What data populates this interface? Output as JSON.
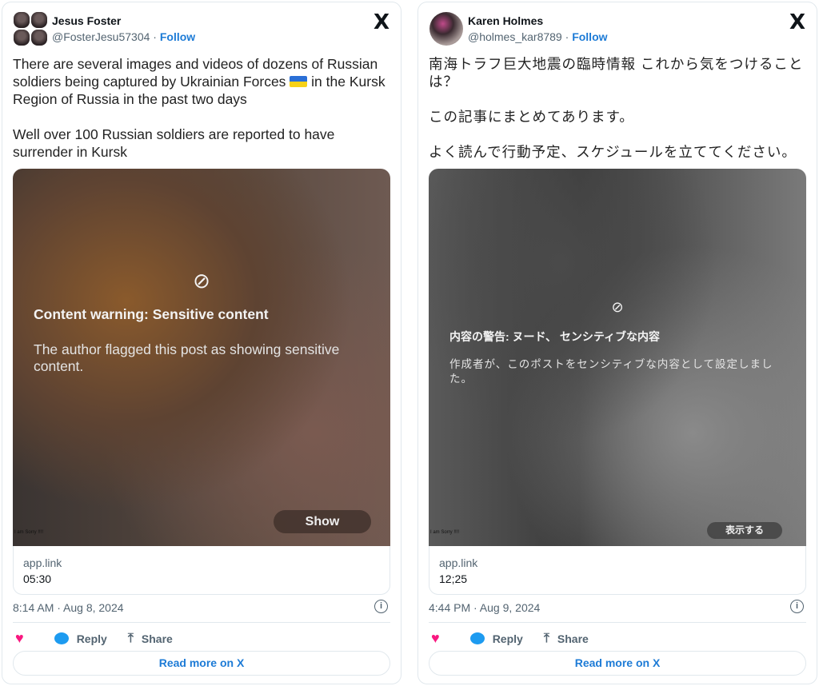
{
  "tweets": [
    {
      "name": "Jesus Foster",
      "handle": "@FosterJesu57304",
      "follow": "Follow",
      "separator": "·",
      "text_before_flag": "There are several images and videos of dozens of Russian soldiers being captured by Ukrainian Forces ",
      "text_after_flag": " in the Kursk Region of Russia in the past two days\n\nWell over 100 Russian soldiers are reported to have surrender in Kursk",
      "warning_title": "Content warning: Sensitive content",
      "warning_body": "The author flagged this post as showing sensitive content.",
      "show_label": "Show",
      "watermark": "I am Sorry !!!!",
      "link_domain": "app.link",
      "link_title": "05:30",
      "timestamp": "8:14 AM · Aug 8, 2024",
      "reply": "Reply",
      "share": "Share",
      "read_more": "Read more on X"
    },
    {
      "name": "Karen Holmes",
      "handle": "@holmes_kar8789",
      "follow": "Follow",
      "separator": "·",
      "text": "南海トラフ巨大地震の臨時情報 これから気をつけることは？\n\nこの記事にまとめてあります。\n\nよく読んで行動予定、スケジュールを立ててください。",
      "warning_title": "内容の警告: ヌード、 センシティブな内容",
      "warning_body": "作成者が、このポストをセンシティブな内容として設定しました。",
      "show_label": "表示する",
      "watermark": "I am Sorry !!!!",
      "link_domain": "app.link",
      "link_title": "12;25",
      "timestamp": "4:44 PM · Aug 9, 2024",
      "reply": "Reply",
      "share": "Share",
      "read_more": "Read more on X"
    }
  ],
  "icons": {
    "logo": "X",
    "info": "i",
    "heart": "♥",
    "share": "⤒",
    "eye_slash": "⊘"
  },
  "colors": {
    "follow": "#1d7bd6",
    "heart": "#f91880",
    "reply": "#1d9bf0"
  }
}
